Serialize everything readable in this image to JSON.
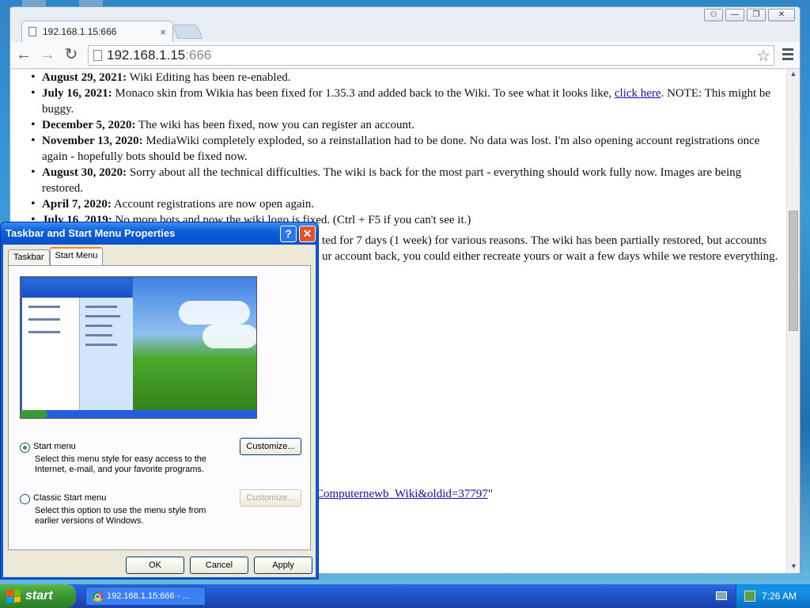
{
  "browser": {
    "tab_title": "192.168.1.15:666",
    "tab_close": "×",
    "url_host": "192.168.1.15",
    "url_port": ":666",
    "window_buttons": [
      "⚇",
      "—",
      "❐",
      "✕"
    ]
  },
  "content": {
    "news": [
      {
        "date": "August 29, 2021:",
        "text": " Wiki Editing has been re-enabled."
      },
      {
        "date": "July 16, 2021:",
        "text": " Monaco skin from Wikia has been fixed for 1.35.3 and added back to the Wiki. To see what it looks like, ",
        "link": "click here",
        "text_after": ". NOTE: This might be buggy."
      },
      {
        "date": "December 5, 2020:",
        "text": " The wiki has been fixed, now you can register an account."
      },
      {
        "date": "November 13, 2020:",
        "text": " MediaWiki completely exploded, so a reinstallation had to be done. No data was lost. I'm also opening account registrations once again - hopefully bots should be fixed now."
      },
      {
        "date": "August 30, 2020:",
        "text": " Sorry about all the technical difficulties. The wiki is back for the most part - everything should work fully now. Images are being restored."
      },
      {
        "date": "April 7, 2020:",
        "text": " Account registrations are now open again."
      },
      {
        "date": "July 16, 2019:",
        "text": " No more bots and now the wiki logo is fixed. (Ctrl + F5 if you can't see it.)"
      }
    ],
    "hidden_line_1": "ted for 7 days (1 week) for various reasons. The wiki has been partially restored, but accounts",
    "hidden_line_2": "ur account back, you could either recreate yours or wait a few days while we restore everything.",
    "bottom_link": "Computernewb_Wiki&oldid=37797",
    "bottom_quote": "\""
  },
  "dialog": {
    "title": "Taskbar and Start Menu Properties",
    "help": "?",
    "close": "✕",
    "tabs": [
      "Taskbar",
      "Start Menu"
    ],
    "active_tab": "Start Menu",
    "option_start_menu": {
      "label": "Start menu",
      "selected": true,
      "description": "Select this menu style for easy access to the Internet, e-mail, and your favorite programs.",
      "customize": "Customize..."
    },
    "option_classic": {
      "label": "Classic Start menu",
      "selected": false,
      "description": "Select this option to use the menu style from earlier versions of Windows.",
      "customize": "Customize..."
    },
    "buttons": {
      "ok": "OK",
      "cancel": "Cancel",
      "apply": "Apply"
    }
  },
  "taskbar": {
    "start_label": "start",
    "task_label": "192.168.1.15:666 - ...",
    "clock": "7:26 AM"
  }
}
